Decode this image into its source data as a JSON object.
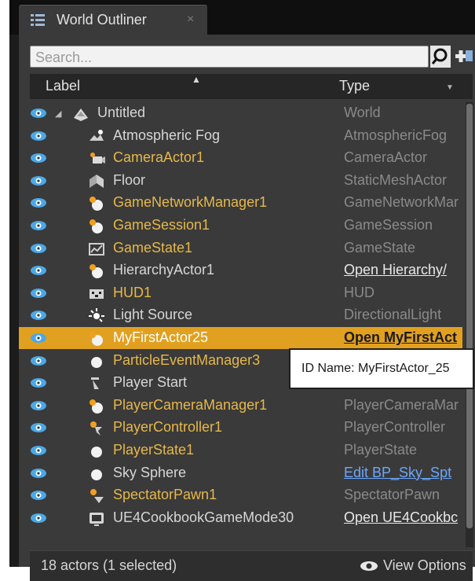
{
  "tab": {
    "title": "World Outliner",
    "close": "×"
  },
  "search": {
    "placeholder": "Search..."
  },
  "columns": {
    "label": "Label",
    "type": "Type"
  },
  "rows": [
    {
      "label": "Untitled",
      "type": "World",
      "icon": "world-icon",
      "kind": "plain",
      "type_style": "plain"
    },
    {
      "label": "Atmospheric Fog",
      "type": "AtmosphericFog",
      "icon": "fog-icon",
      "kind": "plain",
      "type_style": "plain"
    },
    {
      "label": "CameraActor1",
      "type": "CameraActor",
      "icon": "camera-icon",
      "kind": "bp",
      "type_style": "plain"
    },
    {
      "label": "Floor",
      "type": "StaticMeshActor",
      "icon": "mesh-icon",
      "kind": "plain",
      "type_style": "plain"
    },
    {
      "label": "GameNetworkManager1",
      "type": "GameNetworkMar",
      "icon": "actor-icon",
      "kind": "bp",
      "type_style": "plain"
    },
    {
      "label": "GameSession1",
      "type": "GameSession",
      "icon": "actor-icon",
      "kind": "bp",
      "type_style": "plain"
    },
    {
      "label": "GameState1",
      "type": "GameState",
      "icon": "gamestate-icon",
      "kind": "bp",
      "type_style": "plain"
    },
    {
      "label": "HierarchyActor1",
      "type": "Open Hierarchy/",
      "icon": "actor-icon",
      "kind": "plain",
      "type_style": "link"
    },
    {
      "label": "HUD1",
      "type": "HUD",
      "icon": "hud-icon",
      "kind": "bp",
      "type_style": "plain"
    },
    {
      "label": "Light Source",
      "type": "DirectionalLight",
      "icon": "light-icon",
      "kind": "plain",
      "type_style": "plain"
    },
    {
      "label": "MyFirstActor25",
      "type": "Open MyFirstAct",
      "icon": "actor-icon",
      "kind": "plain",
      "type_style": "link",
      "selected": true
    },
    {
      "label": "ParticleEventManager3",
      "type": "",
      "icon": "sphere-icon",
      "kind": "bp",
      "type_style": "plain"
    },
    {
      "label": "Player Start",
      "type": "",
      "icon": "playerstart-icon",
      "kind": "plain",
      "type_style": "plain"
    },
    {
      "label": "PlayerCameraManager1",
      "type": "PlayerCameraMar",
      "icon": "actor-icon",
      "kind": "bp",
      "type_style": "plain"
    },
    {
      "label": "PlayerController1",
      "type": "PlayerController",
      "icon": "controller-icon",
      "kind": "bp",
      "type_style": "plain"
    },
    {
      "label": "PlayerState1",
      "type": "PlayerState",
      "icon": "sphere-icon",
      "kind": "bp",
      "type_style": "plain"
    },
    {
      "label": "Sky Sphere",
      "type": "Edit BP_Sky_Spt",
      "icon": "sphere-icon",
      "kind": "plain",
      "type_style": "edit"
    },
    {
      "label": "SpectatorPawn1",
      "type": "SpectatorPawn",
      "icon": "pawn-icon",
      "kind": "bp",
      "type_style": "plain"
    },
    {
      "label": "UE4CookbookGameMode30",
      "type": "Open UE4Cookbc",
      "icon": "gamemode-icon",
      "kind": "plain",
      "type_style": "link"
    }
  ],
  "tooltip": "ID Name: MyFirstActor_25",
  "footer": {
    "count": "18 actors (1 selected)",
    "view_options": "View Options"
  },
  "colors": {
    "selection": "#e2a020",
    "blueprint_label": "#e6b84a",
    "link": "#6aa8ff",
    "eye": "#4aa8e8"
  }
}
